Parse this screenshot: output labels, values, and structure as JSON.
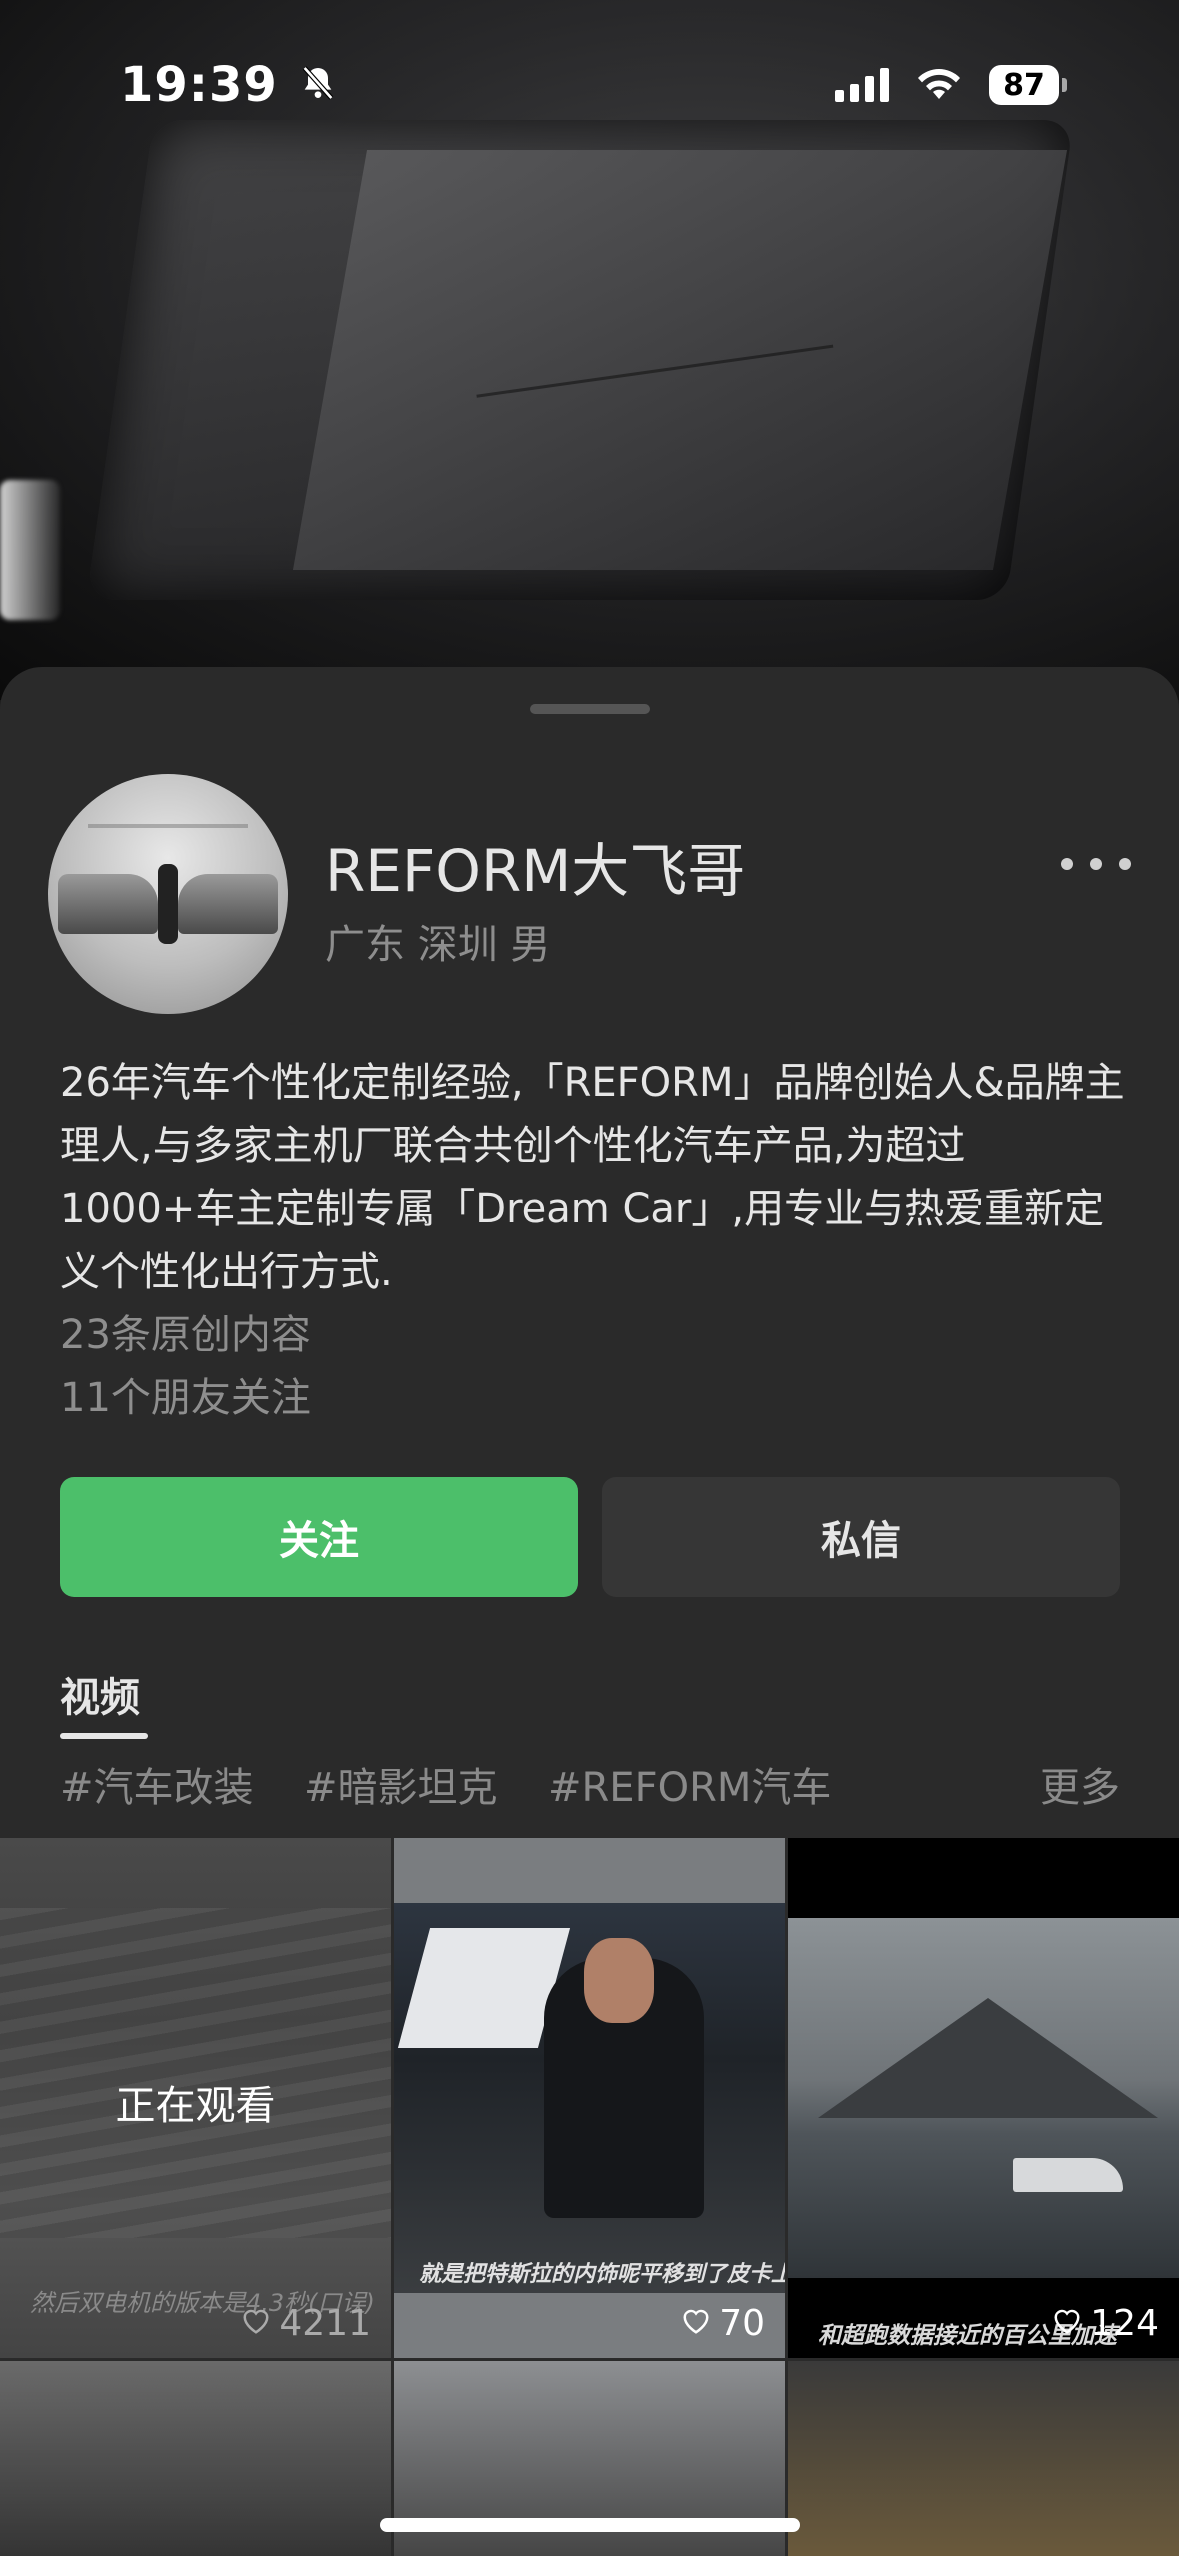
{
  "status_bar": {
    "time": "19:39",
    "battery": "87",
    "icons": [
      "bell-slash-icon",
      "signal-icon",
      "wifi-icon",
      "battery-icon"
    ]
  },
  "profile": {
    "name": "REFORM大飞哥",
    "location": "广东 深圳 男",
    "bio": "26年汽车个性化定制经验,「REFORM」品牌创始人&品牌主理人,与多家主机厂联合共创个性化汽车产品,为超过1000+车主定制专属「Dream Car」,用专业与热爱重新定义个性化出行方式.",
    "original_count": "23条原创内容",
    "friends_following": "11个朋友关注"
  },
  "actions": {
    "follow_label": "关注",
    "message_label": "私信"
  },
  "tabs": {
    "video_label": "视频"
  },
  "tags": {
    "items": [
      "#汽车改装",
      "#暗影坦克",
      "#REFORM汽车"
    ],
    "more_label": "更多"
  },
  "videos": [
    {
      "overlay": "正在观看",
      "caption": "然后双电机的版本是4.3秒(口误)",
      "likes": "4211"
    },
    {
      "caption": "就是把特斯拉的内饰呢平移到了皮卡上面",
      "likes": "70"
    },
    {
      "caption": "和超跑数据接近的百公里加速",
      "likes": "124"
    }
  ],
  "colors": {
    "follow_button": "#4cbf6a",
    "sheet_background": "#2a2a2a",
    "message_button": "#363636"
  }
}
